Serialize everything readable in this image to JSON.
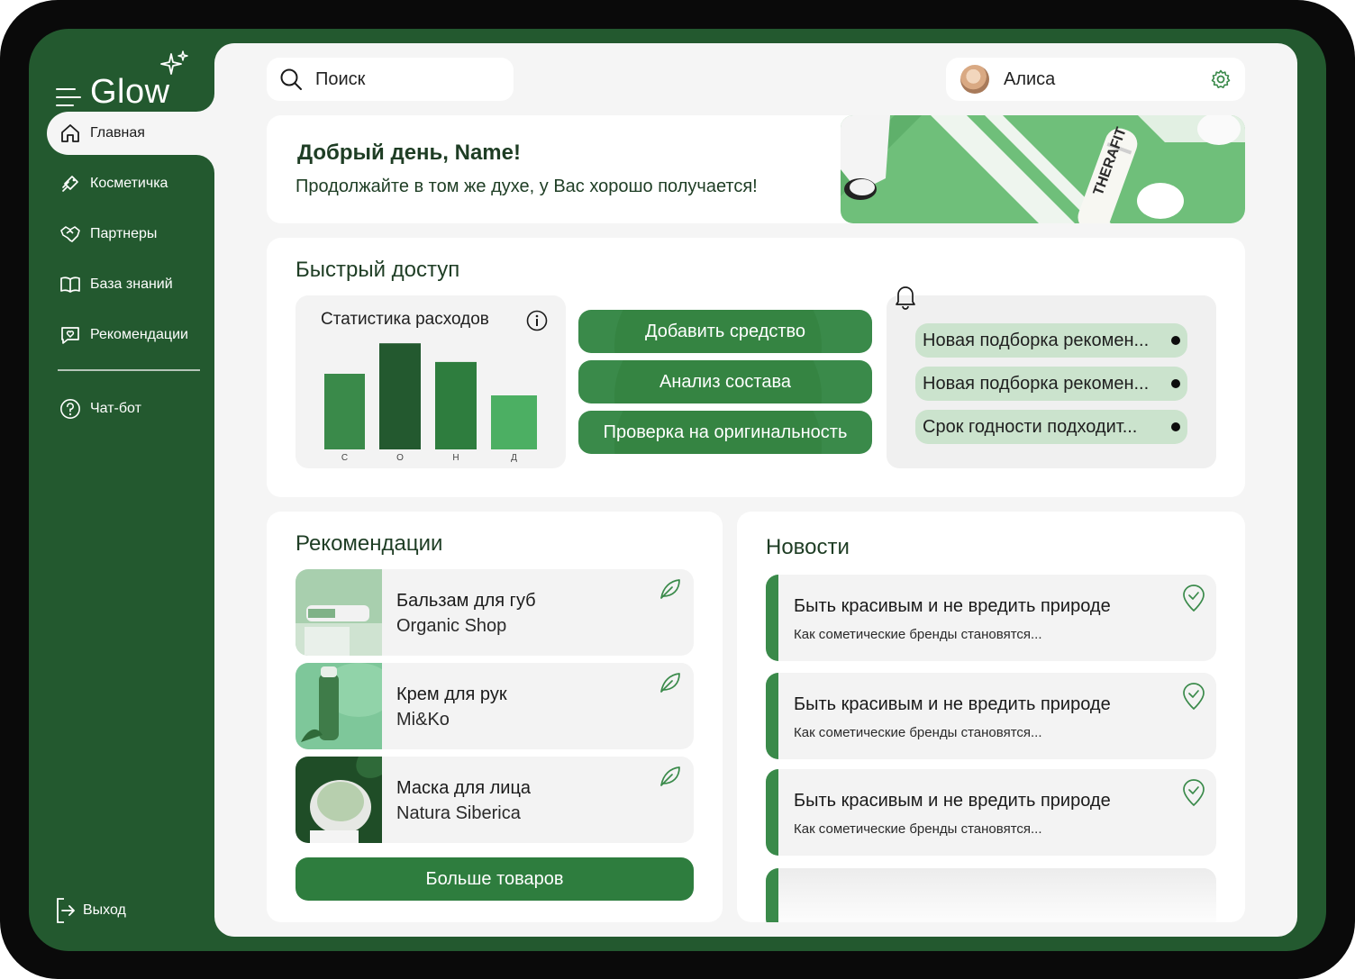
{
  "app": {
    "name": "Glow"
  },
  "sidebar": {
    "items": [
      {
        "label": "Главная",
        "icon": "home-icon"
      },
      {
        "label": "Косметичка",
        "icon": "cosmetics-icon"
      },
      {
        "label": "Партнеры",
        "icon": "handshake-icon"
      },
      {
        "label": "База знаний",
        "icon": "book-icon"
      },
      {
        "label": "Рекомендации",
        "icon": "chat-heart-icon"
      }
    ],
    "chatbot": {
      "label": "Чат-бот",
      "icon": "help-circle-icon"
    },
    "logout": {
      "label": "Выход",
      "icon": "logout-icon"
    }
  },
  "search": {
    "placeholder": "Поиск"
  },
  "user": {
    "name": "Алиса"
  },
  "greeting": {
    "title": "Добрый день, Name!",
    "subtitle": "Продолжайте в том же духе, у Вас хорошо получается!"
  },
  "quick_access": {
    "title": "Быстрый доступ",
    "stats_title": "Статистика расходов",
    "actions": [
      "Добавить средство",
      "Анализ состава",
      "Проверка на оригинальность"
    ],
    "notifications": [
      "Новая подборка рекомен...",
      "Новая подборка рекомен...",
      "Срок годности подходит..."
    ]
  },
  "chart_data": {
    "type": "bar",
    "categories": [
      "С",
      "О",
      "Н",
      "Д"
    ],
    "values": [
      77,
      108,
      89,
      55
    ],
    "ylim": [
      0,
      110
    ],
    "colors": [
      "#3a8a4a",
      "#23592f",
      "#2e7d3e",
      "#4caf63"
    ],
    "grid": false
  },
  "recommendations": {
    "title": "Рекомендации",
    "items": [
      {
        "name": "Бальзам для губ",
        "brand": "Organic Shop"
      },
      {
        "name": "Крем для рук",
        "brand": "Mi&Ko"
      },
      {
        "name": "Маска для лица",
        "brand": "Natura Siberica"
      }
    ],
    "more_label": "Больше товаров"
  },
  "news": {
    "title": "Новости",
    "items": [
      {
        "title": "Быть красивым и не вредить природе",
        "text": "Как сометические бренды становятся..."
      },
      {
        "title": "Быть красивым и не вредить природе",
        "text": "Как сометические бренды становятся..."
      },
      {
        "title": "Быть красивым и не вредить природе",
        "text": "Как сометические бренды становятся..."
      }
    ]
  },
  "colors": {
    "brand_dark": "#23592f",
    "brand": "#3a8a4a",
    "chip": "#cbe3cd",
    "surface": "#f5f5f5"
  }
}
